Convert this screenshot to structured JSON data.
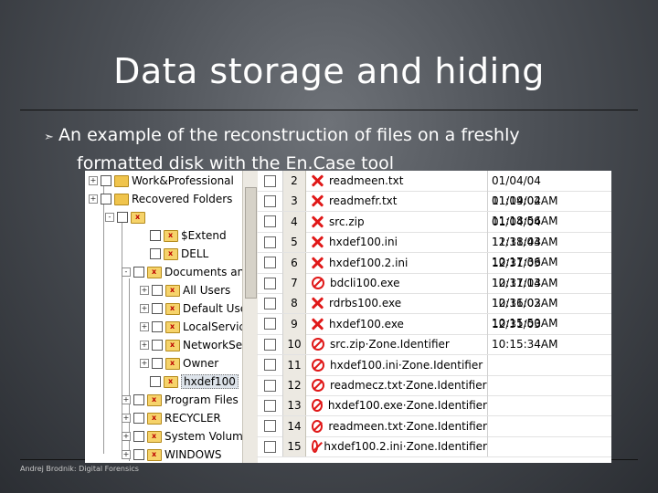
{
  "slide": {
    "title": "Data storage and hiding",
    "bullet_line1": "An example of the reconstruction of files on a freshly",
    "bullet_line2": "formatted disk with the En.Case tool",
    "footer": "Andrej Brodnik: Digital Forensics"
  },
  "tree": {
    "nodes": [
      {
        "label": "Work&Professional",
        "icon": "folder-icon",
        "expander": "+"
      },
      {
        "label": "Recovered Folders",
        "icon": "folder-icon",
        "expander": "+"
      },
      {
        "label": "",
        "icon": "deleted-folder-icon",
        "expander": "-"
      },
      {
        "label": "$Extend",
        "icon": "deleted-folder-icon",
        "expander": ""
      },
      {
        "label": "DELL",
        "icon": "deleted-folder-icon",
        "expander": ""
      },
      {
        "label": "Documents and",
        "icon": "deleted-folder-icon",
        "expander": "-"
      },
      {
        "label": "All Users",
        "icon": "deleted-folder-icon",
        "expander": "+"
      },
      {
        "label": "Default Use",
        "icon": "deleted-folder-icon",
        "expander": "+"
      },
      {
        "label": "LocalService",
        "icon": "deleted-folder-icon",
        "expander": "+"
      },
      {
        "label": "NetworkSer",
        "icon": "deleted-folder-icon",
        "expander": "+"
      },
      {
        "label": "Owner",
        "icon": "deleted-folder-icon",
        "expander": "+"
      },
      {
        "label": "hxdef100",
        "icon": "deleted-folder-icon",
        "expander": ""
      },
      {
        "label": "Program Files",
        "icon": "deleted-folder-icon",
        "expander": "+"
      },
      {
        "label": "RECYCLER",
        "icon": "deleted-folder-icon",
        "expander": "+"
      },
      {
        "label": "System Volume",
        "icon": "deleted-folder-icon",
        "expander": "+"
      },
      {
        "label": "WINDOWS",
        "icon": "deleted-folder-icon",
        "expander": "+"
      }
    ]
  },
  "files": {
    "rows": [
      {
        "num": "2",
        "name": "readmeen.txt",
        "icon": "deleted-file-x-icon",
        "date": "01/04/04 11:19:02AM"
      },
      {
        "num": "3",
        "name": "readmefr.txt",
        "icon": "deleted-file-x-icon",
        "date": "01/04/04 11:18:56AM"
      },
      {
        "num": "4",
        "name": "src.zip",
        "icon": "deleted-file-x-icon",
        "date": "01/04/04 11:18:44AM"
      },
      {
        "num": "5",
        "name": "hxdef100.ini",
        "icon": "deleted-file-x-icon",
        "date": "12/31/03 10:17:36AM"
      },
      {
        "num": "6",
        "name": "hxdef100.2.ini",
        "icon": "deleted-file-x-icon",
        "date": "12/31/03 10:17:14AM"
      },
      {
        "num": "7",
        "name": "bdcli100.exe",
        "icon": "overwritten-file-icon",
        "date": "12/31/03 10:16:02AM"
      },
      {
        "num": "8",
        "name": "rdrbs100.exe",
        "icon": "deleted-file-x-icon",
        "date": "12/31/03 10:15:50AM"
      },
      {
        "num": "9",
        "name": "hxdef100.exe",
        "icon": "deleted-file-x-icon",
        "date": "12/31/03 10:15:34AM"
      },
      {
        "num": "10",
        "name": "src.zip·Zone.Identifier",
        "icon": "overwritten-file-icon",
        "date": ""
      },
      {
        "num": "11",
        "name": "hxdef100.ini·Zone.Identifier",
        "icon": "overwritten-file-icon",
        "date": ""
      },
      {
        "num": "12",
        "name": "readmecz.txt·Zone.Identifier",
        "icon": "overwritten-file-icon",
        "date": ""
      },
      {
        "num": "13",
        "name": "hxdef100.exe·Zone.Identifier",
        "icon": "overwritten-file-icon",
        "date": ""
      },
      {
        "num": "14",
        "name": "readmeen.txt·Zone.Identifier",
        "icon": "overwritten-file-icon",
        "date": ""
      },
      {
        "num": "15",
        "name": "hxdef100.2.ini·Zone.Identifier",
        "icon": "overwritten-file-icon",
        "date": ""
      }
    ]
  },
  "colors": {
    "deleted_mark": "#e01818",
    "folder": "#f0c44c"
  }
}
